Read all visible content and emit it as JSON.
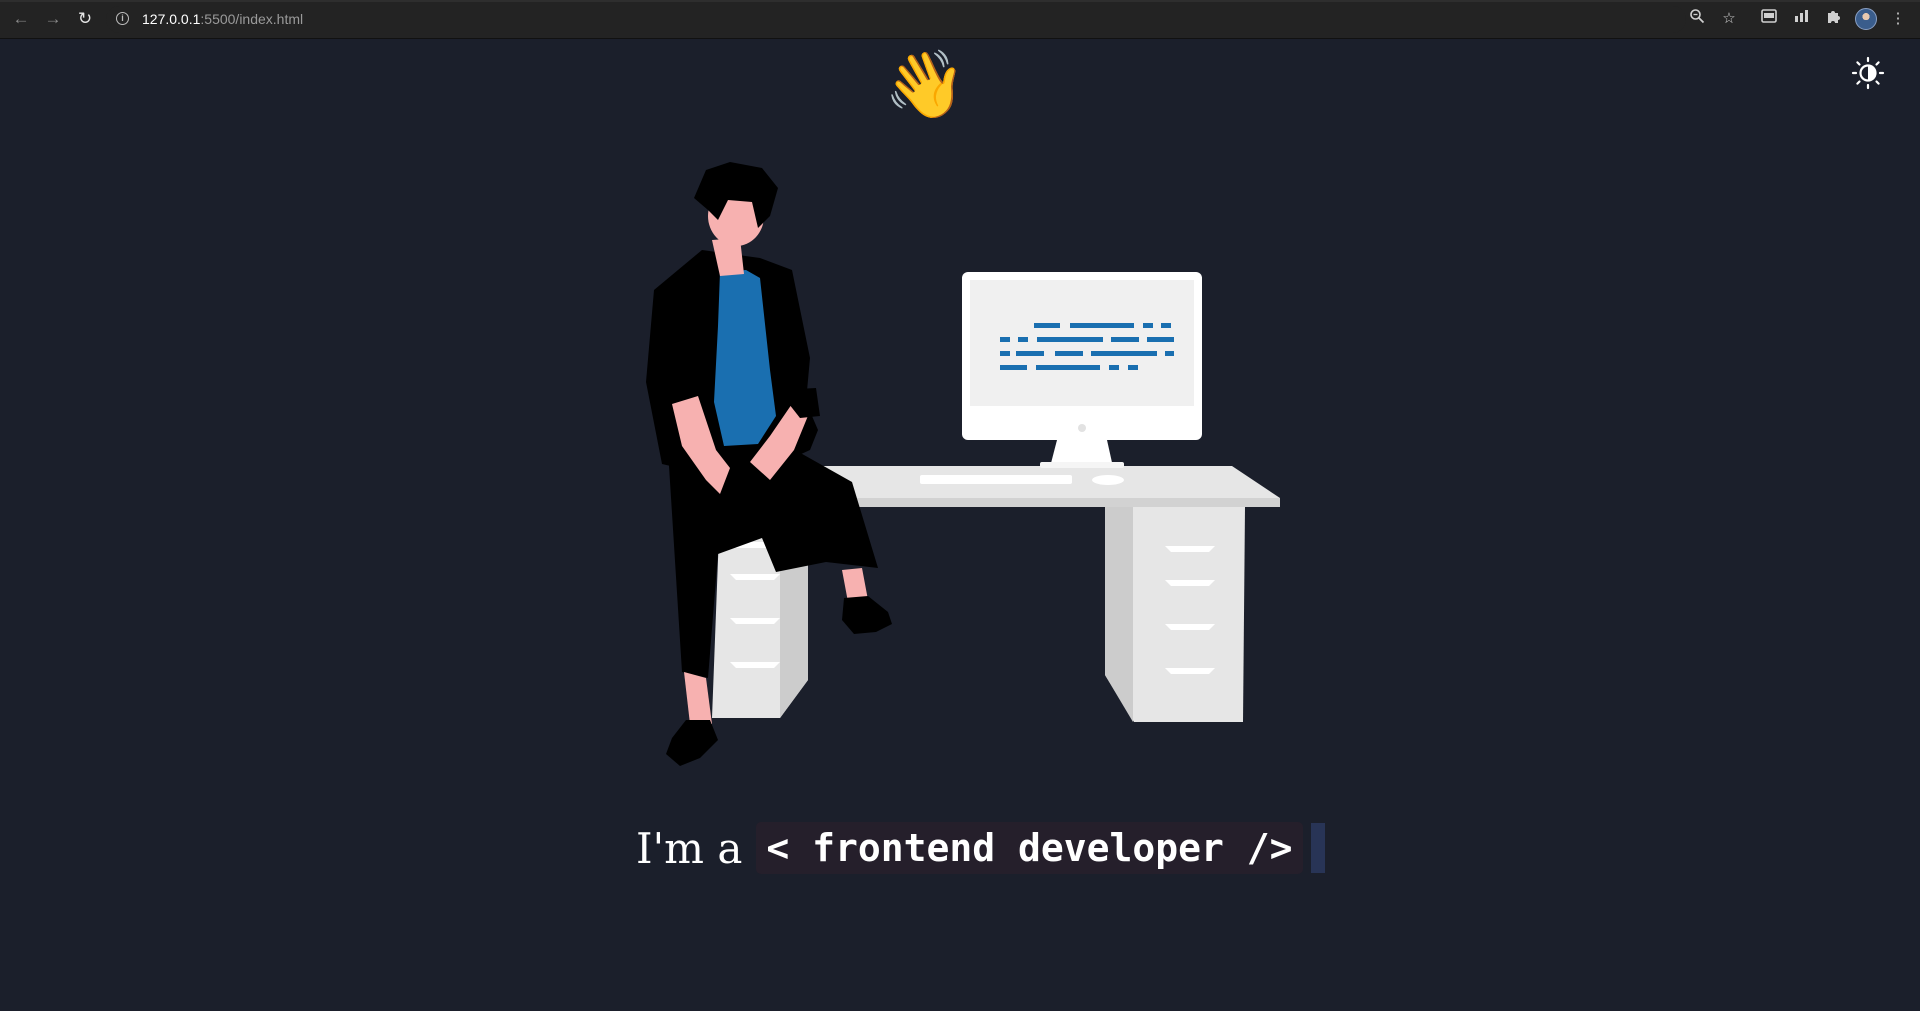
{
  "browser": {
    "url_host": "127.0.0.1",
    "url_rest": ":5500/index.html",
    "back_icon": "arrow-back-icon",
    "forward_icon": "arrow-forward-icon",
    "reload_icon": "reload-icon",
    "info_icon": "info-icon",
    "zoom_icon": "zoom-icon",
    "star_icon": "star-icon",
    "extension_icons": [
      "extension-card-icon",
      "extension-chart-icon",
      "puzzle-icon"
    ],
    "menu_icon": "kebab-menu-icon"
  },
  "page": {
    "theme_toggle_icon": "sun-moon-icon",
    "wave_emoji": "👋",
    "tagline_prefix": "I'm a",
    "tagline_code": "< frontend developer />",
    "colors": {
      "background": "#1b1f2b",
      "code_background": "#251f2b",
      "cursor": "#283456",
      "accent_blue": "#1a6fb0",
      "skin": "#f7b1b0"
    }
  }
}
